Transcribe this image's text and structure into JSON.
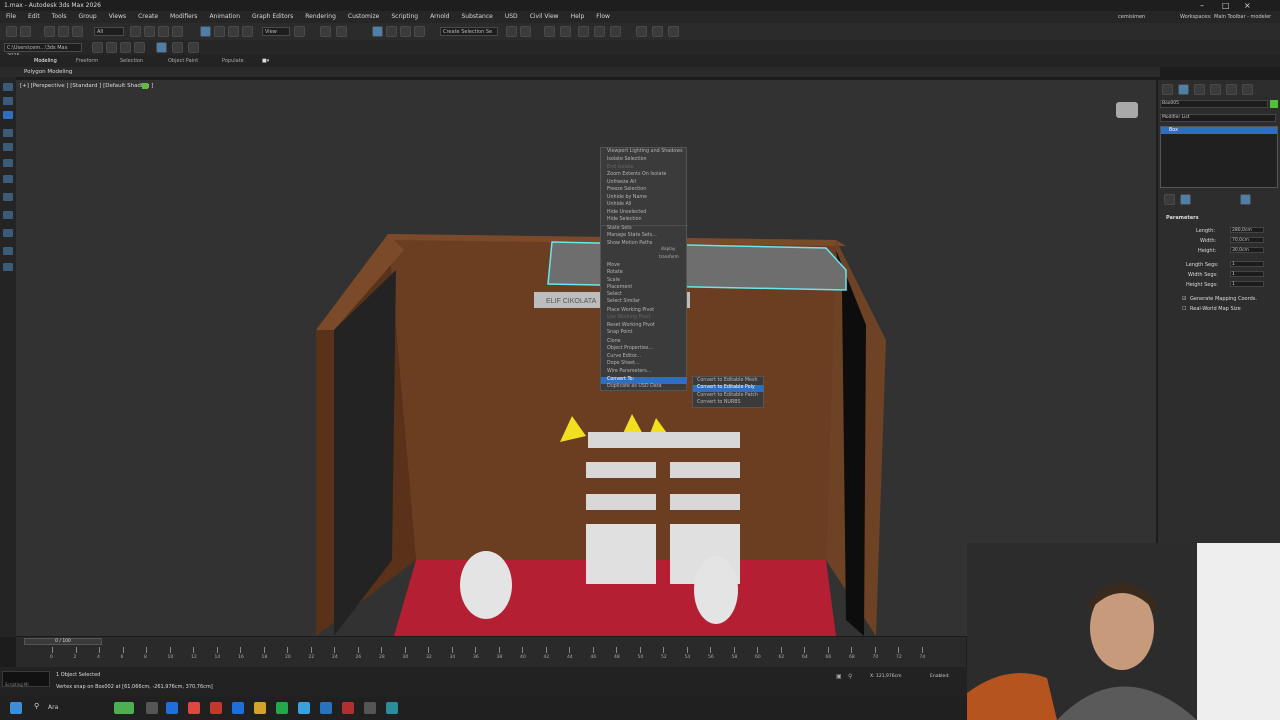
{
  "window": {
    "title": "1.max - Autodesk 3ds Max 2026"
  },
  "menubar": {
    "items": [
      "File",
      "Edit",
      "Tools",
      "Group",
      "Views",
      "Create",
      "Modifiers",
      "Animation",
      "Graph Editors",
      "Rendering",
      "Customize",
      "Scripting",
      "Arnold",
      "Substance",
      "USD",
      "Civil View",
      "Help",
      "Flow"
    ],
    "user": "cemisimen",
    "workspaces_label": "Workspaces:",
    "workspace_value": "Main Toolbar - modeler"
  },
  "toolbar": {
    "filter_value": "All",
    "view_value": "View",
    "selection_set_placeholder": "Create Selection Se"
  },
  "path_field": {
    "value": "C:\\Users\\cem...\\3ds Max 2026"
  },
  "ribbon": {
    "tabs": [
      "Modeling",
      "Freeform",
      "Selection",
      "Object Paint",
      "Populate"
    ],
    "active_panel": "Polygon Modeling"
  },
  "viewport": {
    "label": "[+] [Perspective ] [Standard ] [Default Shading ]",
    "sign_text": "ELIF CIKOLATA",
    "colors": {
      "wall": "#6b3e22",
      "floor": "#b51f33",
      "selection": "#65e8f0",
      "light": "#f0e020"
    }
  },
  "context_menu": {
    "items": [
      "Viewport Lighting and Shadows",
      "Isolate Selection",
      "End Isolate",
      "Zoom Extents On Isolate",
      "Unfreeze All",
      "Freeze Selection",
      "Unhide by Name",
      "Unhide All",
      "Hide Unselected",
      "Hide Selection",
      "State Sets",
      "Manage State Sets...",
      "Show Motion Paths",
      "Move",
      "Rotate",
      "Scale",
      "Placement",
      "Select",
      "Select Similar",
      "Place Working Pivot",
      "Use Working Pivot",
      "Reset Working Pivot",
      "Snap Point",
      "Clone",
      "Object Properties...",
      "Curve Editor...",
      "Dope Sheet...",
      "Wire Parameters...",
      "Convert To:",
      "Duplicate as USD Data"
    ],
    "quad_labels": {
      "display": "display",
      "transform": "transform"
    },
    "highlighted": "Convert To:"
  },
  "submenu": {
    "items": [
      "Convert to Editable Mesh",
      "Convert to Editable Poly",
      "Convert to Editable Patch",
      "Convert to NURBS"
    ],
    "highlighted": "Convert to Editable Poly"
  },
  "command_panel": {
    "object_name": "Box005",
    "modifier_list_label": "Modifier List",
    "stack_item": "Box",
    "rollout_title": "Parameters",
    "params": [
      {
        "label": "Length:",
        "value": "280,0cm"
      },
      {
        "label": "Width:",
        "value": "70,0cm"
      },
      {
        "label": "Height:",
        "value": "30,0cm"
      },
      {
        "label": "Length Segs:",
        "value": "1"
      },
      {
        "label": "Width Segs:",
        "value": "1"
      },
      {
        "label": "Height Segs:",
        "value": "1"
      }
    ],
    "checkboxes": [
      {
        "label": "Generate Mapping Coords.",
        "checked": true
      },
      {
        "label": "Real-World Map Size",
        "checked": false
      }
    ]
  },
  "timeline": {
    "frame_counter": "0 / 100",
    "ticks": [
      "0",
      "2",
      "4",
      "6",
      "8",
      "10",
      "12",
      "14",
      "16",
      "18",
      "20",
      "22",
      "24",
      "26",
      "28",
      "30",
      "32",
      "34",
      "36",
      "38",
      "40",
      "42",
      "44",
      "46",
      "48",
      "50",
      "52",
      "54",
      "56",
      "58",
      "60",
      "62",
      "64",
      "66",
      "68",
      "70",
      "72",
      "74"
    ]
  },
  "status": {
    "selection": "1 Object Selected",
    "prompt": "Vertex snap on Box002 at [61,066cm, -261,976cm, 370,76cm]",
    "script_label": "Scripting Mi",
    "coords": "X: 121,976cm",
    "enabled_label": "Enabled:"
  },
  "taskbar": {
    "search_label": "Ara"
  }
}
